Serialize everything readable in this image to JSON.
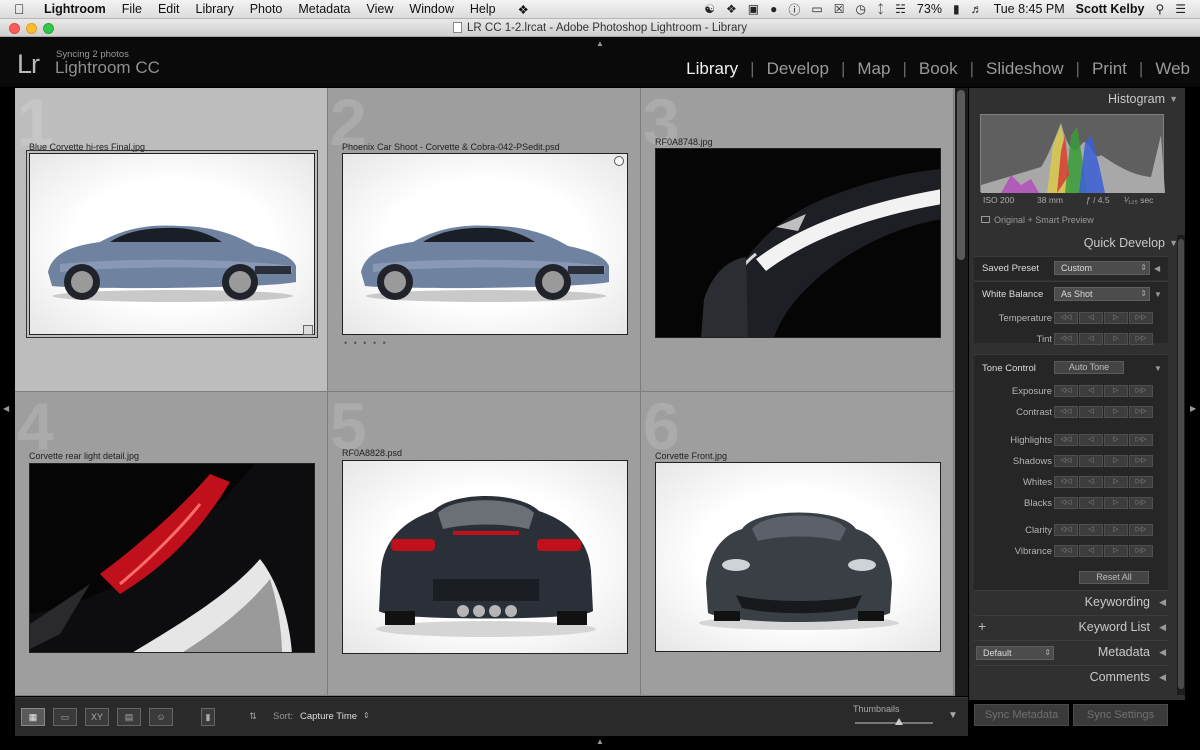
{
  "menubar": {
    "app_name": "Lightroom",
    "items": [
      "File",
      "Edit",
      "Library",
      "Photo",
      "Metadata",
      "View",
      "Window",
      "Help"
    ],
    "battery": "73%",
    "clock": "Tue 8:45 PM",
    "user": "Scott Kelby"
  },
  "window": {
    "title": "LR CC 1-2.lrcat - Adobe Photoshop Lightroom - Library"
  },
  "identity": {
    "logo": "Lr",
    "sync_status": "Syncing 2 photos",
    "product": "Lightroom CC"
  },
  "modules": [
    "Library",
    "Develop",
    "Map",
    "Book",
    "Slideshow",
    "Print",
    "Web"
  ],
  "active_module": "Library",
  "grid": {
    "cells": [
      {
        "num": "1",
        "filename": "Blue Corvette hi-res Final.jpg"
      },
      {
        "num": "2",
        "filename": "Phoenix Car Shoot - Corvette & Cobra-042-PSedit.psd"
      },
      {
        "num": "3",
        "filename": "RF0A8748.jpg"
      },
      {
        "num": "4",
        "filename": "Corvette rear light detail.jpg"
      },
      {
        "num": "5",
        "filename": "RF0A8828.psd"
      },
      {
        "num": "6",
        "filename": "Corvette Front.jpg"
      }
    ],
    "rating_dots": "• • • • •"
  },
  "panel": {
    "histogram": {
      "title": "Histogram",
      "iso": "ISO 200",
      "focal": "38 mm",
      "aperture": "ƒ / 4.5",
      "shutter": "¹⁄₁₂₅ sec",
      "preview_status": "Original + Smart Preview"
    },
    "quick_develop": {
      "title": "Quick Develop",
      "saved_preset_label": "Saved Preset",
      "saved_preset_value": "Custom",
      "white_balance_label": "White Balance",
      "white_balance_value": "As Shot",
      "temperature": "Temperature",
      "tint": "Tint",
      "tone_control_label": "Tone Control",
      "auto_tone": "Auto Tone",
      "tone_rows": [
        "Exposure",
        "Contrast"
      ],
      "tone_rows2": [
        "Highlights",
        "Shadows",
        "Whites",
        "Blacks"
      ],
      "presence_rows": [
        "Clarity",
        "Vibrance"
      ],
      "reset_all": "Reset All",
      "step_buttons": [
        "◁◁",
        "◁",
        "▷",
        "▷▷"
      ]
    },
    "keywording": "Keywording",
    "keyword_list": "Keyword List",
    "keyword_plus": "+",
    "metadata": "Metadata",
    "metadata_preset": "Default",
    "comments": "Comments",
    "sync_metadata": "Sync Metadata",
    "sync_settings": "Sync Settings"
  },
  "toolbar": {
    "sort_label": "Sort:",
    "sort_value": "Capture Time",
    "thumbnails_label": "Thumbnails",
    "thumbnail_size": 0.56
  },
  "colors": {
    "car_blue": "#6f82a0",
    "car_dark": "#2b3038",
    "tail_red": "#c0101c"
  }
}
